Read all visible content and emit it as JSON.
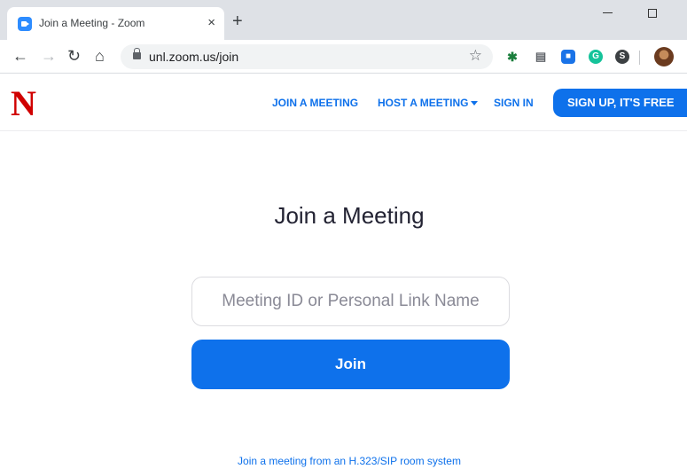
{
  "browser": {
    "tab_title": "Join a Meeting - Zoom",
    "tab_close": "×",
    "new_tab": "+",
    "url": "unl.zoom.us/join",
    "icons": [
      "back-arrow-icon",
      "forward-arrow-icon",
      "reload-icon",
      "home-icon",
      "lock-icon",
      "star-icon",
      "extension-icons",
      "profile-avatar"
    ]
  },
  "header": {
    "logo": "N",
    "nav": {
      "join": "JOIN A MEETING",
      "host": "HOST A MEETING",
      "signin": "SIGN IN"
    },
    "signup": "SIGN UP, IT'S FREE"
  },
  "main": {
    "title": "Join a Meeting",
    "input_placeholder": "Meeting ID or Personal Link Name",
    "join_button": "Join",
    "room_link": "Join a meeting from an H.323/SIP room system"
  },
  "colors": {
    "accent": "#0e71eb",
    "logo_red": "#d00000"
  }
}
